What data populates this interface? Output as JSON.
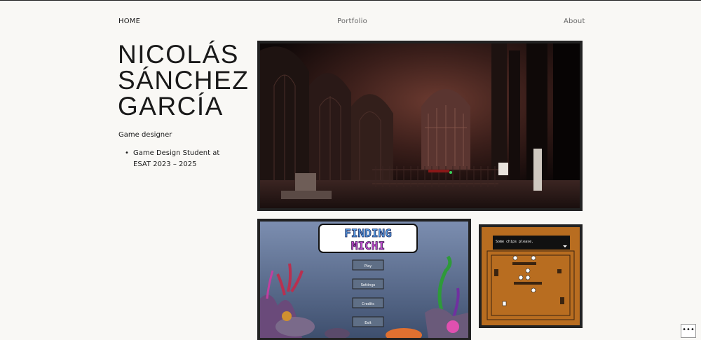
{
  "nav": {
    "home": "HOME",
    "portfolio": "Portfolio",
    "about": "About"
  },
  "site": {
    "title": "NICOLÁS SÁNCHEZ GARCÍA",
    "subtitle": "Game designer",
    "bullets": [
      "Game Design Student at ESAT 2023 – 2025"
    ]
  },
  "gallery": {
    "game2": {
      "logo_line1": "FINDING",
      "logo_line2": "MICHI",
      "menu": [
        "Play",
        "Settings",
        "Credits",
        "Exit"
      ]
    },
    "game3": {
      "dialog": "Some chips please."
    }
  },
  "more_button": "•••"
}
